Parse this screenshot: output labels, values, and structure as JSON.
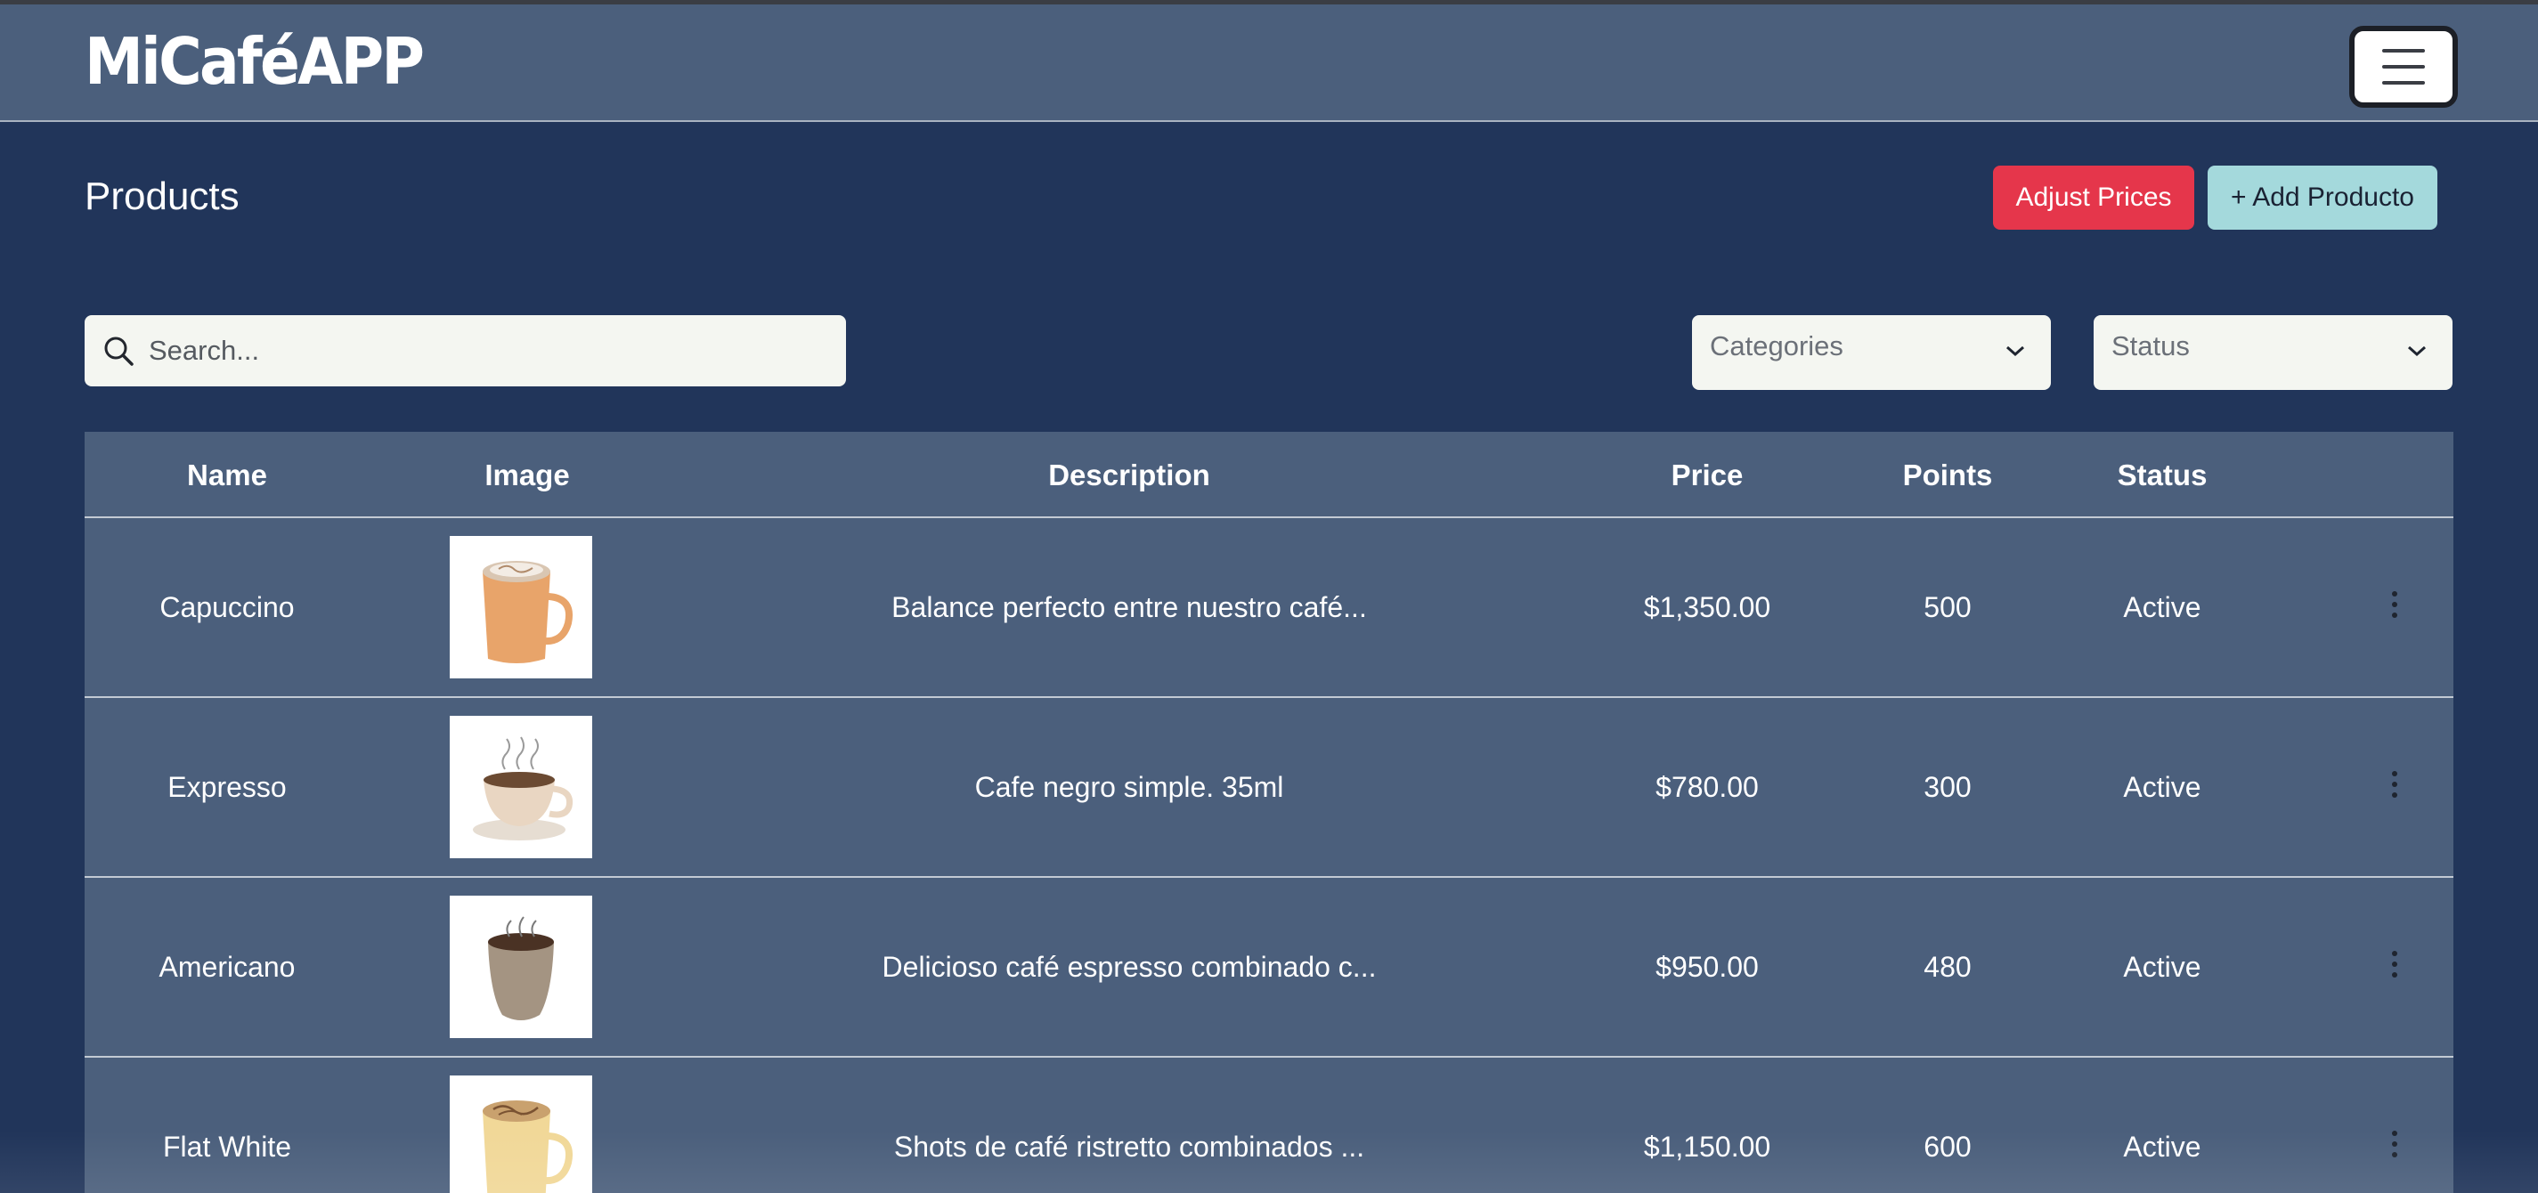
{
  "app": {
    "brand": "MiCaféAPP"
  },
  "header": {
    "menu_icon": "hamburger-menu-icon"
  },
  "page": {
    "title": "Products",
    "adjust_label": "Adjust Prices",
    "add_label": "+ Add Producto"
  },
  "filters": {
    "search_placeholder": "Search...",
    "search_icon": "search-icon",
    "categories_label": "Categories",
    "status_label": "Status",
    "dropdown_icon": "chevron-down-icon"
  },
  "colors": {
    "page_bg": "#21355a",
    "panel_bg": "#4b5f7c",
    "danger": "#e5364b",
    "info": "#a4d9dc",
    "input_bg": "#f4f6f1"
  },
  "table": {
    "headers": {
      "name": "Name",
      "image": "Image",
      "description": "Description",
      "price": "Price",
      "points": "Points",
      "status": "Status"
    },
    "rows": [
      {
        "name": "Capuccino",
        "description": "Balance perfecto entre nuestro café...",
        "price": "$1,350.00",
        "points": "500",
        "status": "Active",
        "image_icon": "cappuccino-mug-icon"
      },
      {
        "name": "Expresso",
        "description": "Cafe negro simple. 35ml",
        "price": "$780.00",
        "points": "300",
        "status": "Active",
        "image_icon": "espresso-cup-icon"
      },
      {
        "name": "Americano",
        "description": "Delicioso café espresso combinado c...",
        "price": "$950.00",
        "points": "480",
        "status": "Active",
        "image_icon": "americano-cup-icon"
      },
      {
        "name": "Flat White",
        "description": "Shots de café ristretto combinados ...",
        "price": "$1,150.00",
        "points": "600",
        "status": "Active",
        "image_icon": "flat-white-mug-icon"
      }
    ]
  }
}
